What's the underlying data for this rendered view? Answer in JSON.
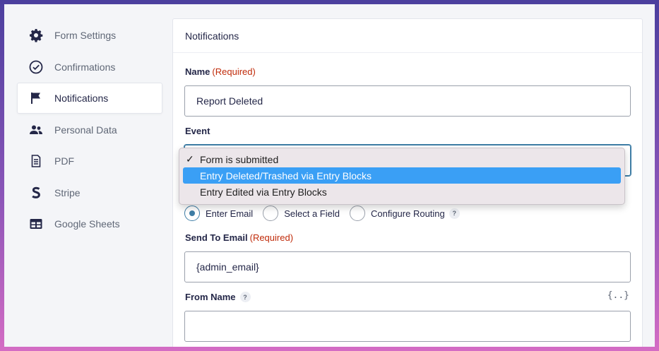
{
  "sidebar": {
    "items": [
      {
        "label": "Form Settings",
        "icon": "gear-icon"
      },
      {
        "label": "Confirmations",
        "icon": "check-circle-icon"
      },
      {
        "label": "Notifications",
        "icon": "flag-icon",
        "active": true
      },
      {
        "label": "Personal Data",
        "icon": "users-icon"
      },
      {
        "label": "PDF",
        "icon": "document-icon"
      },
      {
        "label": "Stripe",
        "icon": "stripe-icon"
      },
      {
        "label": "Google Sheets",
        "icon": "table-icon"
      }
    ]
  },
  "panel": {
    "title": "Notifications",
    "name_label": "Name",
    "required": "(Required)",
    "name_value": "Report Deleted",
    "event_label": "Event",
    "send_to": {
      "options": [
        "Enter Email",
        "Select a Field",
        "Configure Routing"
      ],
      "selected": "Enter Email",
      "help": "?"
    },
    "send_to_email_label": "Send To Email",
    "send_to_email_value": "{admin_email}",
    "from_name_label": "From Name",
    "from_name_help": "?",
    "merge_tag": "{..}",
    "from_name_value": ""
  },
  "dropdown": {
    "checkmark": "✓",
    "options": [
      "Form is submitted",
      "Entry Deleted/Trashed via Entry Blocks",
      "Entry Edited via Entry Blocks"
    ],
    "checked": "Form is submitted",
    "highlighted": "Entry Deleted/Trashed via Entry Blocks"
  },
  "colors": {
    "accent": "#3e7da6",
    "required": "#c02b0a",
    "highlight": "#3a9ff5"
  }
}
